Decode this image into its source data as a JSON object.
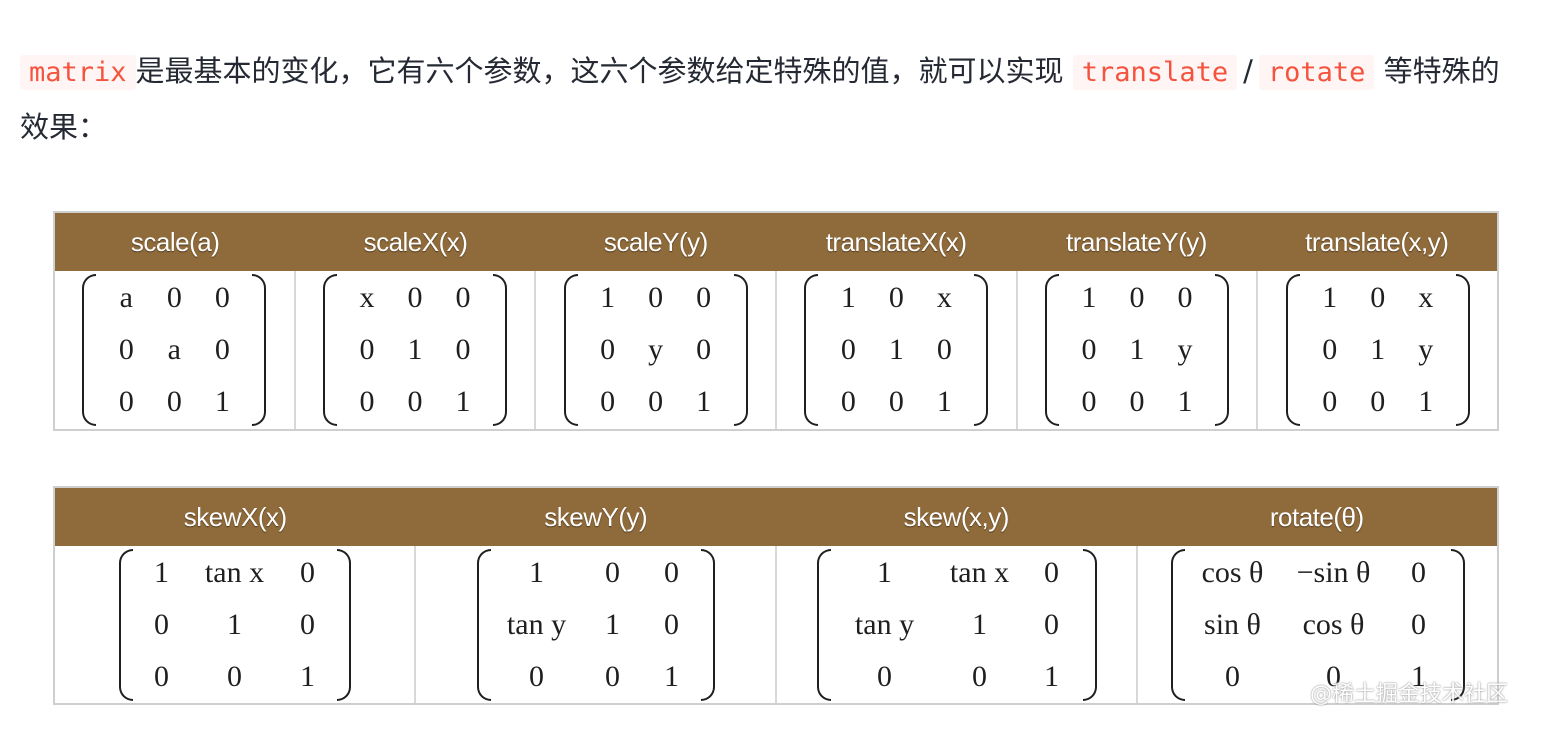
{
  "intro": {
    "code1": "matrix",
    "text1": "是最基本的变化，它有六个参数，这六个参数给定特殊的值，就可以实现",
    "code2": "translate",
    "slash": "/",
    "code3": "rotate",
    "text2": "等特殊的效果："
  },
  "table1": {
    "columns": [
      {
        "title": "scale(a)",
        "rows": [
          [
            "a",
            "0",
            "0"
          ],
          [
            "0",
            "a",
            "0"
          ],
          [
            "0",
            "0",
            "1"
          ]
        ]
      },
      {
        "title": "scaleX(x)",
        "rows": [
          [
            "x",
            "0",
            "0"
          ],
          [
            "0",
            "1",
            "0"
          ],
          [
            "0",
            "0",
            "1"
          ]
        ]
      },
      {
        "title": "scaleY(y)",
        "rows": [
          [
            "1",
            "0",
            "0"
          ],
          [
            "0",
            "y",
            "0"
          ],
          [
            "0",
            "0",
            "1"
          ]
        ]
      },
      {
        "title": "translateX(x)",
        "rows": [
          [
            "1",
            "0",
            "x"
          ],
          [
            "0",
            "1",
            "0"
          ],
          [
            "0",
            "0",
            "1"
          ]
        ]
      },
      {
        "title": "translateY(y)",
        "rows": [
          [
            "1",
            "0",
            "0"
          ],
          [
            "0",
            "1",
            "y"
          ],
          [
            "0",
            "0",
            "1"
          ]
        ]
      },
      {
        "title": "translate(x,y)",
        "rows": [
          [
            "1",
            "0",
            "x"
          ],
          [
            "0",
            "1",
            "y"
          ],
          [
            "0",
            "0",
            "1"
          ]
        ]
      }
    ]
  },
  "table2": {
    "columns": [
      {
        "title": "skewX(x)",
        "rows": [
          [
            "1",
            "tan x",
            "0"
          ],
          [
            "0",
            "1",
            "0"
          ],
          [
            "0",
            "0",
            "1"
          ]
        ]
      },
      {
        "title": "skewY(y)",
        "rows": [
          [
            "1",
            "0",
            "0"
          ],
          [
            "tan y",
            "1",
            "0"
          ],
          [
            "0",
            "0",
            "1"
          ]
        ]
      },
      {
        "title": "skew(x,y)",
        "rows": [
          [
            "1",
            "tan x",
            "0"
          ],
          [
            "tan y",
            "1",
            "0"
          ],
          [
            "0",
            "0",
            "1"
          ]
        ]
      },
      {
        "title": "rotate(θ)",
        "rows": [
          [
            "cos θ",
            "−sin θ",
            "0"
          ],
          [
            "sin θ",
            "cos θ",
            "0"
          ],
          [
            "0",
            "0",
            "1"
          ]
        ]
      }
    ]
  },
  "watermark": "@稀土掘金技术社区",
  "colors": {
    "header_bg": "#8f6a3a",
    "code_text": "#f5533d",
    "code_bg": "#fff5f5"
  }
}
